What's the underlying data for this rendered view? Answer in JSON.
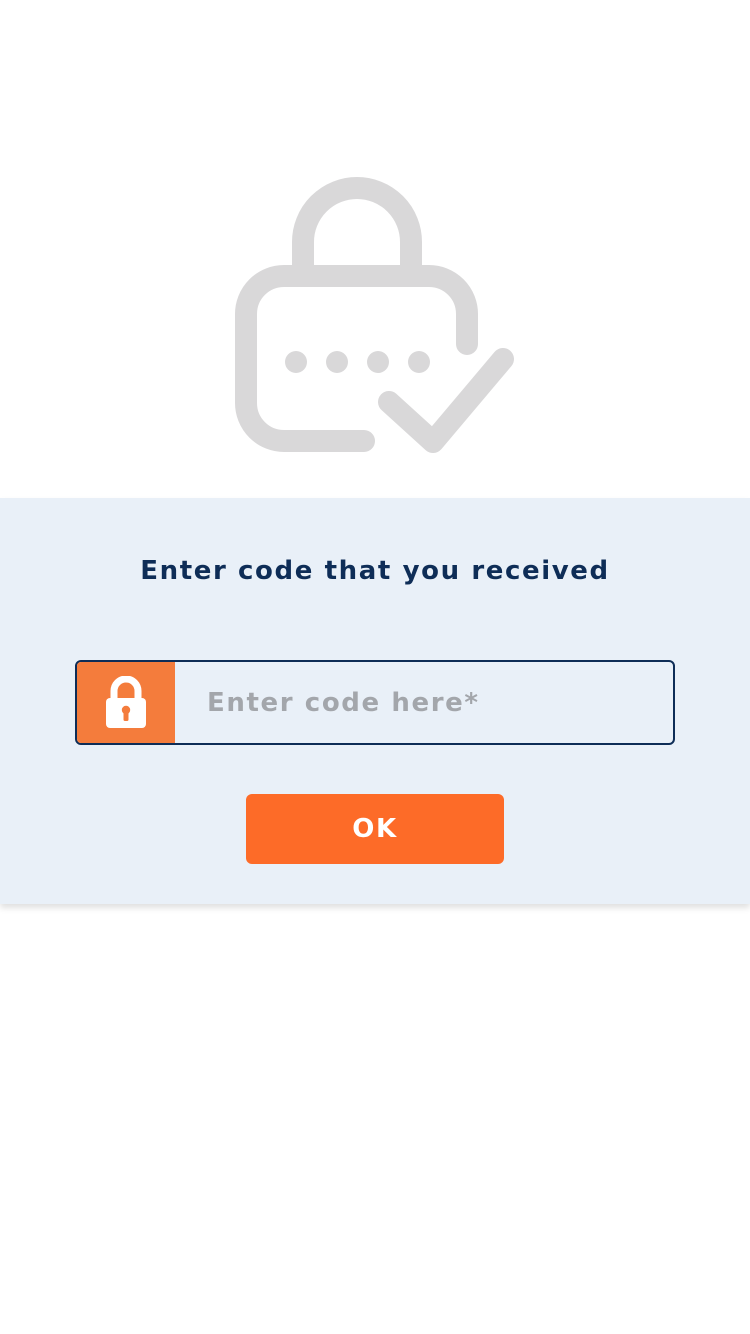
{
  "hero": {
    "icon": "lock-code-check-icon",
    "icon_color": "#d9d8d9"
  },
  "verify": {
    "prompt": "Enter code that you received",
    "code_field": {
      "icon": "lock-icon",
      "icon_background": "#f47c3c",
      "placeholder": "Enter code here*",
      "value": ""
    },
    "ok_label": "OK",
    "ok_color": "#fd6b28",
    "panel_color": "#e9f0f8",
    "text_color": "#0e2d57"
  }
}
